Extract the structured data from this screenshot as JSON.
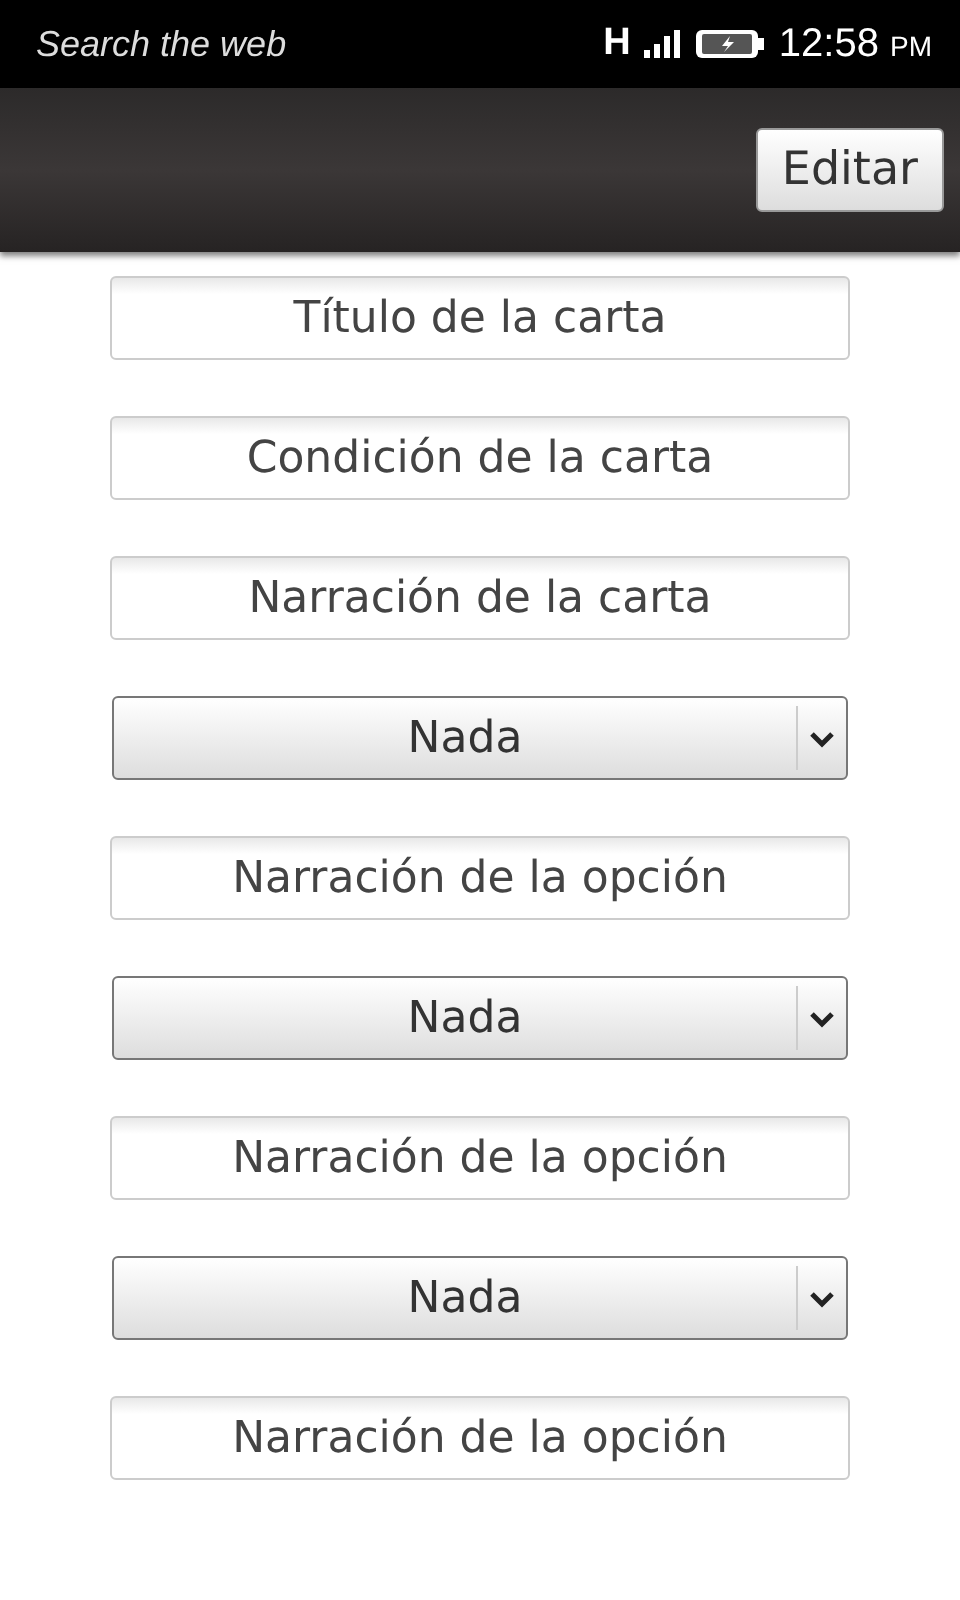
{
  "status_bar": {
    "notification": "Search the web",
    "network": "H",
    "time": "12:58",
    "ampm": "PM"
  },
  "action_bar": {
    "button": "Editar"
  },
  "fields": [
    {
      "kind": "text",
      "placeholder": "Título de la carta"
    },
    {
      "kind": "text",
      "placeholder": "Condición de la carta"
    },
    {
      "kind": "text",
      "placeholder": "Narración de la carta"
    },
    {
      "kind": "select",
      "value": "Nada"
    },
    {
      "kind": "text",
      "placeholder": "Narración de la opción"
    },
    {
      "kind": "select",
      "value": "Nada"
    },
    {
      "kind": "text",
      "placeholder": "Narración de la opción"
    },
    {
      "kind": "select",
      "value": "Nada"
    },
    {
      "kind": "text",
      "placeholder": "Narración de la opción"
    }
  ]
}
